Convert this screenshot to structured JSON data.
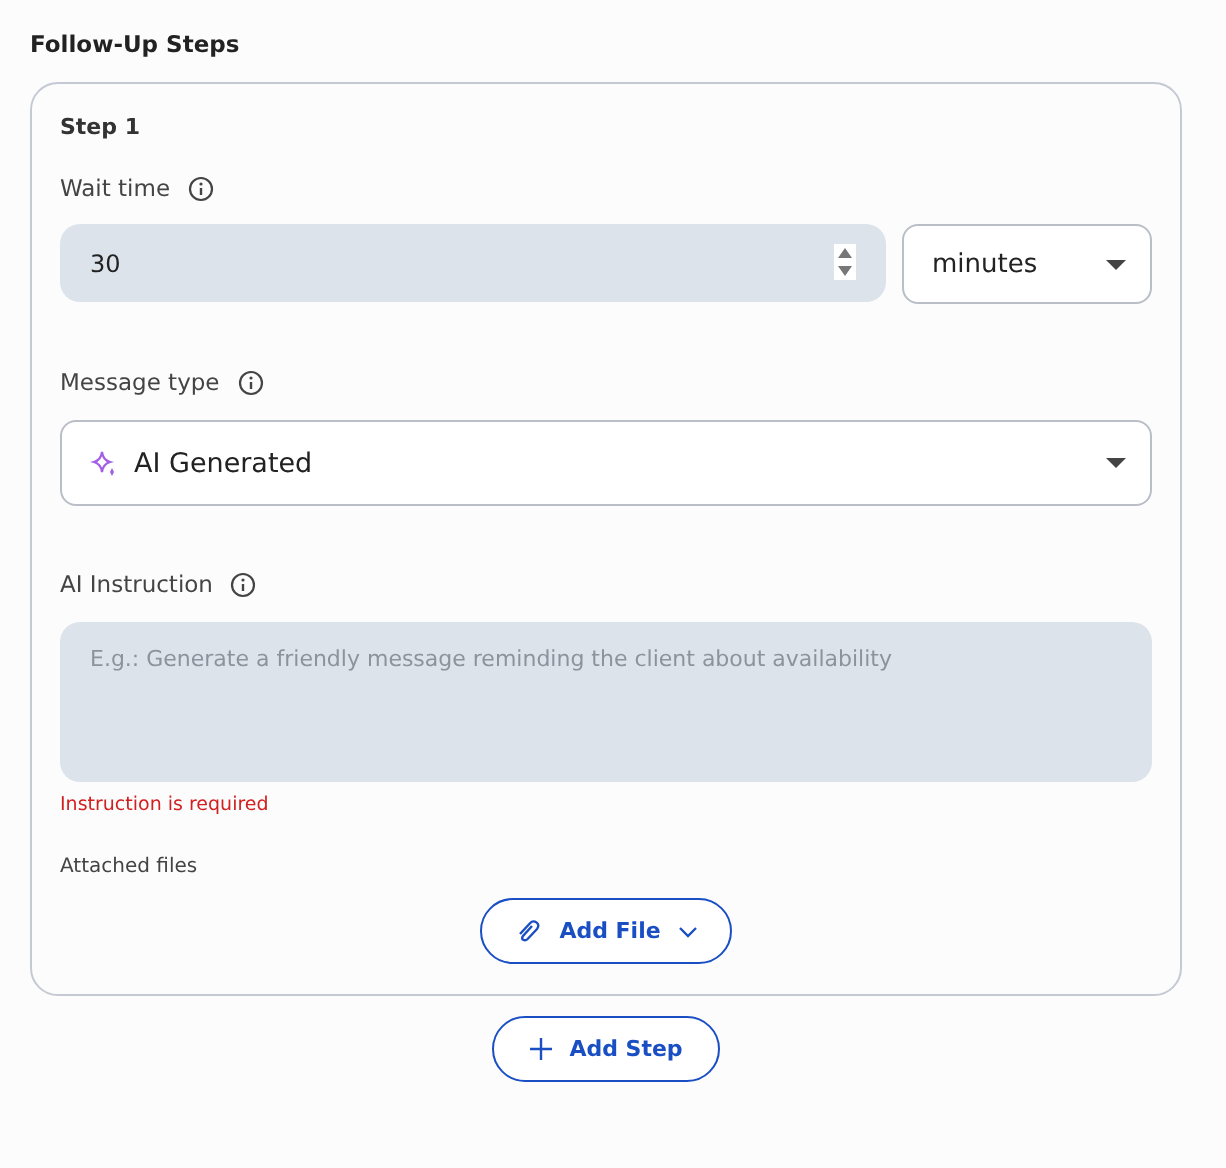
{
  "title": "Follow-Up Steps",
  "steps": [
    {
      "heading": "Step 1",
      "wait_time": {
        "label": "Wait time",
        "value": "30",
        "unit": "minutes"
      },
      "message_type": {
        "label": "Message type",
        "value": "AI Generated"
      },
      "ai_instruction": {
        "label": "AI Instruction",
        "placeholder": "E.g.: Generate a friendly message reminding the client about availability",
        "error": "Instruction is required"
      },
      "attachments": {
        "label": "Attached files",
        "button": "Add File"
      }
    }
  ],
  "add_step_button": "Add Step"
}
